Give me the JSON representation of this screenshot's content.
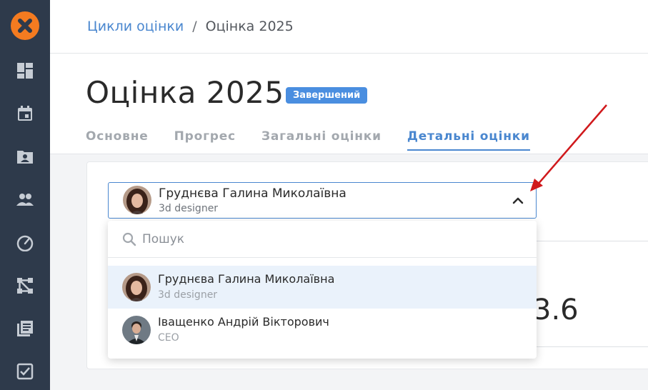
{
  "breadcrumb": {
    "link": "Цикли оцінки",
    "separator": "/",
    "current": "Оцінка 2025"
  },
  "page": {
    "title": "Оцінка 2025",
    "status_badge": "Завершений"
  },
  "tabs": [
    {
      "label": "Основне",
      "active": false
    },
    {
      "label": "Прогрес",
      "active": false
    },
    {
      "label": "Загальні оцінки",
      "active": false
    },
    {
      "label": "Детальні оцінки",
      "active": true
    }
  ],
  "sidebar": {
    "icons": [
      "dashboard-icon",
      "calendar-icon",
      "folder-user-icon",
      "people-icon",
      "gauge-icon",
      "workflow-icon",
      "library-icon",
      "checkbox-icon"
    ]
  },
  "employee_select": {
    "selected_name": "Груднєва Галина Миколаївна",
    "selected_role": "3d designer"
  },
  "dropdown": {
    "search_placeholder": "Пошук",
    "options": [
      {
        "name": "Груднєва Галина Миколаївна",
        "role": "3d designer",
        "selected": true
      },
      {
        "name": "Іващенко Андрій Вікторович",
        "role": "CEO",
        "selected": false
      }
    ]
  },
  "card": {
    "score_fragment": "3.6"
  },
  "colors": {
    "accent": "#4a87cf",
    "sidebar": "#2e3a4b",
    "logo": "#f47b20",
    "arrow": "#d0191c"
  }
}
